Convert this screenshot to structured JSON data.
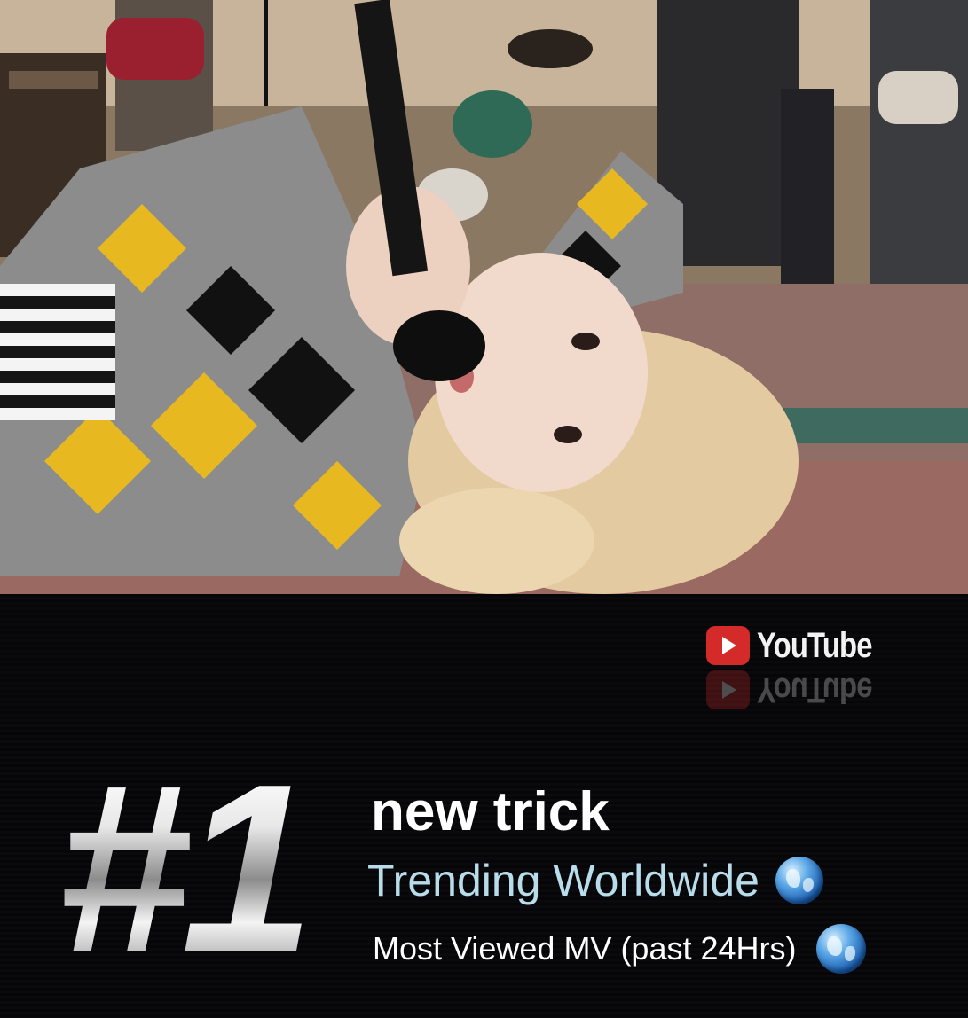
{
  "brand": {
    "name": "YouTube",
    "color": "#d42a2a"
  },
  "rank": "#1",
  "song_title": "new trick",
  "trending_line": "Trending Worldwide",
  "most_viewed_line": "Most Viewed MV (past 24Hrs)",
  "icons": {
    "trending": "globe-icon",
    "most_viewed": "globe-icon",
    "logo": "youtube-play-icon"
  },
  "colors": {
    "trending_text": "#b9dceb",
    "background": "#050507"
  }
}
